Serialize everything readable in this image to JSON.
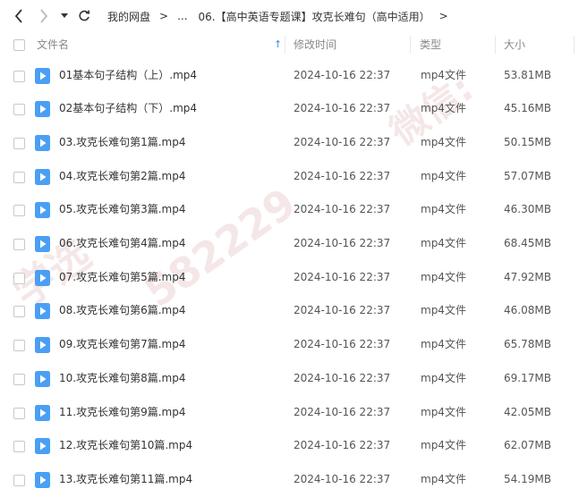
{
  "toolbar": {
    "back_icon": "chevron-left-icon",
    "forward_icon": "chevron-right-icon",
    "history_icon": "caret-down-icon",
    "refresh_icon": "refresh-icon"
  },
  "breadcrumb": {
    "root": "我的网盘",
    "ellipsis": "...",
    "current": "06.【高中英语专题课】攻克长难句（高中适用）",
    "separator": ">"
  },
  "columns": {
    "name": "文件名",
    "sort_icon": "↑",
    "modified": "修改时间",
    "type": "类型",
    "size": "大小"
  },
  "files": [
    {
      "name": "01基本句子结构（上）.mp4",
      "modified": "2024-10-16 22:37",
      "type": "mp4文件",
      "size": "53.81MB"
    },
    {
      "name": "02基本句子结构（下）.mp4",
      "modified": "2024-10-16 22:37",
      "type": "mp4文件",
      "size": "45.16MB"
    },
    {
      "name": "03.攻克长难句第1篇.mp4",
      "modified": "2024-10-16 22:37",
      "type": "mp4文件",
      "size": "50.15MB"
    },
    {
      "name": "04.攻克长难句第2篇.mp4",
      "modified": "2024-10-16 22:37",
      "type": "mp4文件",
      "size": "57.07MB"
    },
    {
      "name": "05.攻克长难句第3篇.mp4",
      "modified": "2024-10-16 22:37",
      "type": "mp4文件",
      "size": "46.30MB"
    },
    {
      "name": "06.攻克长难句第4篇.mp4",
      "modified": "2024-10-16 22:37",
      "type": "mp4文件",
      "size": "68.45MB"
    },
    {
      "name": "07.攻克长难句第5篇.mp4",
      "modified": "2024-10-16 22:37",
      "type": "mp4文件",
      "size": "47.92MB"
    },
    {
      "name": "08.攻克长难句第6篇.mp4",
      "modified": "2024-10-16 22:37",
      "type": "mp4文件",
      "size": "46.08MB"
    },
    {
      "name": "09.攻克长难句第7篇.mp4",
      "modified": "2024-10-16 22:37",
      "type": "mp4文件",
      "size": "65.78MB"
    },
    {
      "name": "10.攻克长难句第8篇.mp4",
      "modified": "2024-10-16 22:37",
      "type": "mp4文件",
      "size": "69.17MB"
    },
    {
      "name": "11.攻克长难句第9篇.mp4",
      "modified": "2024-10-16 22:37",
      "type": "mp4文件",
      "size": "42.05MB"
    },
    {
      "name": "12.攻克长难句第10篇.mp4",
      "modified": "2024-10-16 22:37",
      "type": "mp4文件",
      "size": "62.07MB"
    },
    {
      "name": "13.攻克长难句第11篇.mp4",
      "modified": "2024-10-16 22:37",
      "type": "mp4文件",
      "size": "54.19MB"
    }
  ],
  "watermark": {
    "line1": "学选",
    "line2": "微信:",
    "number": "582229"
  },
  "colors": {
    "accent": "#3a8ee6",
    "icon": "#4a9ff5"
  }
}
